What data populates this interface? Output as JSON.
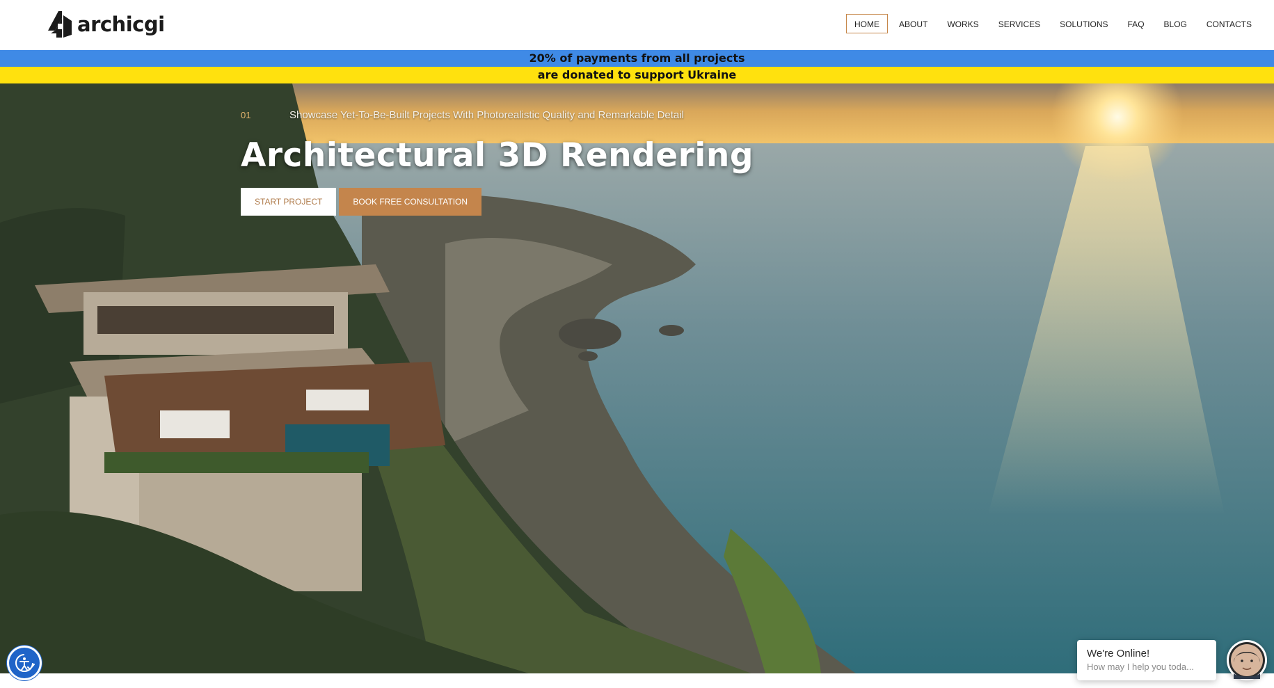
{
  "colors": {
    "accent": "#c4854c",
    "ua_blue": "#3f8ae6",
    "ua_yellow": "#ffe10e",
    "a11y_blue": "#1f64c8"
  },
  "header": {
    "logo_text": "archicgi",
    "logo_icon": "archicgi-logo-icon",
    "nav": [
      {
        "label": "HOME",
        "active": true
      },
      {
        "label": "ABOUT"
      },
      {
        "label": "WORKS"
      },
      {
        "label": "SERVICES"
      },
      {
        "label": "SOLUTIONS"
      },
      {
        "label": "FAQ"
      },
      {
        "label": "BLOG"
      },
      {
        "label": "CONTACTS"
      }
    ]
  },
  "banner": {
    "line1": "20% of payments from all projects",
    "line2": "are donated to support Ukraine"
  },
  "hero": {
    "slide_number": "01",
    "tagline": "Showcase Yet-To-Be-Built Projects With Photorealistic Quality and Remarkable Detail",
    "title": "Architectural 3D Rendering",
    "primary_cta": "START PROJECT",
    "secondary_cta": "BOOK FREE CONSULTATION",
    "background_image": "cliffside-villa-ocean-sunset-render"
  },
  "accessibility": {
    "icon": "accessibility-icon"
  },
  "chat": {
    "status": "We're Online!",
    "prompt": "How may I help you toda...",
    "avatar": "agent-avatar-icon"
  }
}
